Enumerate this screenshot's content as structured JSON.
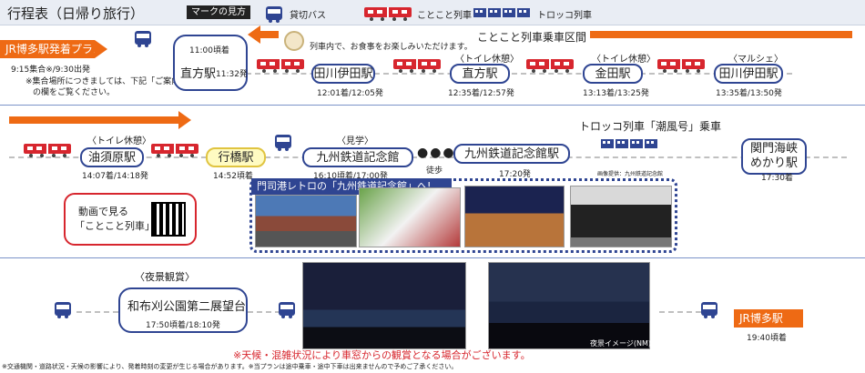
{
  "header": {
    "title": "行程表（日帰り旅行）",
    "legend_title": "マークの見方",
    "legend_bus": "貸切バス",
    "legend_train": "ことこと列車",
    "legend_trolley": "トロッコ列車"
  },
  "row1": {
    "plan_tag": "JR博多駅発着プラン",
    "meet_time": "9:15集合※/9:30出発",
    "meet_note_1": "※集合場所につきましては、下記「ご案内」",
    "meet_note_2": "の欄をご覧ください。",
    "meal_note": "列車内で、お食事をお楽しみいただけます。",
    "section_label": "ことこと列車乗車区間",
    "nogata_arrive": "11:00頃着",
    "nogata_name": "直方駅",
    "nogata_depart": "11:32発",
    "s1": {
      "name": "田川伊田駅",
      "time": "12:01着/12:05発",
      "note": ""
    },
    "s2": {
      "name": "直方駅",
      "time": "12:35着/12:57発",
      "note": "〈トイレ休憩〉"
    },
    "s3": {
      "name": "金田駅",
      "time": "13:13着/13:25発",
      "note": "〈トイレ休憩〉"
    },
    "s4": {
      "name": "田川伊田駅",
      "time": "13:35着/13:50発",
      "note": "〈マルシェ〉"
    }
  },
  "row2": {
    "s1": {
      "name": "油須原駅",
      "time": "14:07着/14:18発",
      "note": "〈トイレ休憩〉"
    },
    "s2": {
      "name": "行橋駅",
      "time": "14:52頃着"
    },
    "s3": {
      "name": "九州鉄道記念館",
      "time": "16:10頃着/17:00発",
      "note": "〈見学〉"
    },
    "walk": "徒歩",
    "s4": {
      "name": "九州鉄道記念館駅",
      "time": "17:20発"
    },
    "trolley_label": "トロッコ列車「潮風号」乗車",
    "s5": {
      "name_1": "関門海峡",
      "name_2": "めかり駅",
      "time": "17:30着"
    },
    "video_1": "動画で見る",
    "video_2": "「ことこと列車」",
    "promo_title": "門司港レトロの「九州鉄道記念館」へ!",
    "photo_credit": "画像提供：九州鉄道記念館"
  },
  "row3": {
    "night_note": "〈夜景観賞〉",
    "park_name": "和布刈公園第二展望台",
    "park_time": "17:50頃着/18:10発",
    "warning": "※天候・混雑状況により車窓からの観賞となる場合がございます。",
    "night_caption": "夜景イメージ(NM)",
    "hakata_name": "JR博多駅",
    "hakata_time": "19:40頃着"
  },
  "footer": {
    "note": "※交通機関・道路状況・天候の影響により、発着時刻の変更が生じる場合があります。※当プランは途中乗車・途中下車は出来ませんので予めご了承ください。"
  },
  "colors": {
    "navy": "#2f4592",
    "orange": "#ee6a14",
    "train_red": "#d7262e",
    "highlight": "#fffbc2"
  }
}
